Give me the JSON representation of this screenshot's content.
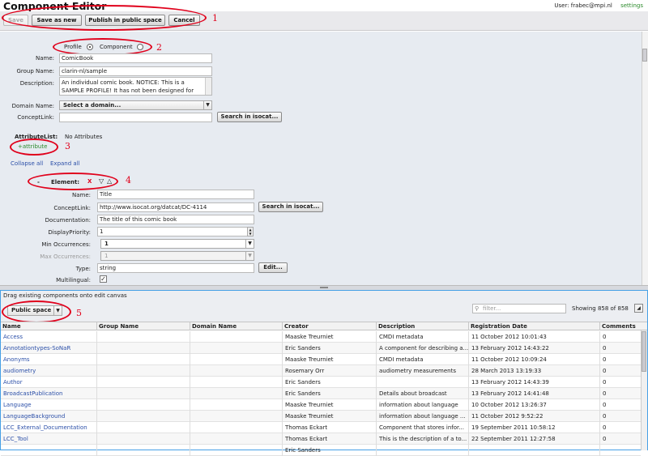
{
  "header": {
    "title": "Component Editor",
    "user": "User: frabec@mpi.nl",
    "settings": "settings"
  },
  "toolbar": {
    "save": "Save",
    "save_as_new": "Save as new",
    "publish": "Publish in public space",
    "cancel": "Cancel"
  },
  "editor": {
    "type_options": {
      "profile": "Profile",
      "component": "Component",
      "selected": "Profile"
    },
    "name_label": "Name:",
    "name_value": "ComicBook",
    "group_label": "Group Name:",
    "group_value": "clarin-nl/sample",
    "description_label": "Description:",
    "description_value": "An individual comic book. NOTICE: This is a SAMPLE PROFILE! It has not been designed for",
    "domain_label": "Domain Name:",
    "domain_value": "Select a domain...",
    "concept_label": "ConceptLink:",
    "concept_value": "",
    "search_isocat": "Search in isocat...",
    "attribute_list_label": "AttributeList:",
    "attribute_list_value": "No Attributes",
    "add_attribute": "+attribute",
    "collapse_all": "Collapse all",
    "expand_all": "Expand all"
  },
  "element": {
    "toggle": "-",
    "label": "Element:",
    "remove": "X",
    "name_label": "Name:",
    "name_value": "Title",
    "concept_label": "ConceptLink:",
    "concept_value": "http://www.isocat.org/datcat/DC-4114",
    "search_isocat": "Search in isocat...",
    "doc_label": "Documentation:",
    "doc_value": "The title of this comic book",
    "priority_label": "DisplayPriority:",
    "priority_value": "1",
    "min_label": "Min Occurrences:",
    "min_value": "1",
    "max_label": "Max Occurrences:",
    "max_value": "1",
    "type_label": "Type:",
    "type_value": "string",
    "edit": "Edit...",
    "multilingual_label": "Multilingual:",
    "multilingual_checked": true
  },
  "annotations": [
    "1",
    "2",
    "3",
    "4",
    "5"
  ],
  "browser": {
    "hint": "Drag existing components onto edit canvas",
    "space": "Public space",
    "filter_placeholder": "filter...",
    "showing": "Showing 858 of 858",
    "columns": [
      "Name",
      "Group Name",
      "Domain Name",
      "Creator",
      "Description",
      "Registration Date",
      "Comments"
    ],
    "rows": [
      [
        "Access",
        "",
        "",
        "Maaske Treurniet",
        "CMDI metadata",
        "11 October 2012 10:01:43",
        "0"
      ],
      [
        "Annotationtypes-SoNaR",
        "",
        "",
        "Eric Sanders",
        "A component for describing a...",
        "13 February 2012 14:43:22",
        "0"
      ],
      [
        "Anonyms",
        "",
        "",
        "Maaske Treurniet",
        "CMDI metadata",
        "11 October 2012 10:09:24",
        "0"
      ],
      [
        "audiometry",
        "",
        "",
        "Rosemary Orr",
        "audiometry measurements",
        "28 March 2013 13:19:33",
        "0"
      ],
      [
        "Author",
        "",
        "",
        "Eric Sanders",
        "",
        "13 February 2012 14:43:39",
        "0"
      ],
      [
        "BroadcastPublication",
        "",
        "",
        "Eric Sanders",
        "Details about broadcast",
        "13 February 2012 14:41:48",
        "0"
      ],
      [
        "Language",
        "",
        "",
        "Maaske Treurniet",
        "information about language",
        "10 October 2012 13:26:37",
        "0"
      ],
      [
        "LanguageBackground",
        "",
        "",
        "Maaske Treurniet",
        "information about language ...",
        "11 October 2012 9:52:22",
        "0"
      ],
      [
        "LCC_External_Documentation",
        "",
        "",
        "Thomas Eckart",
        "Component that stores infor...",
        "19 September 2011 10:58:12",
        "0"
      ],
      [
        "LCC_Tool",
        "",
        "",
        "Thomas Eckart",
        "This is the description of a to...",
        "22 September 2011 12:27:58",
        "0"
      ],
      [
        "",
        "",
        "",
        "Eric Sanders",
        "",
        "",
        ""
      ]
    ]
  }
}
